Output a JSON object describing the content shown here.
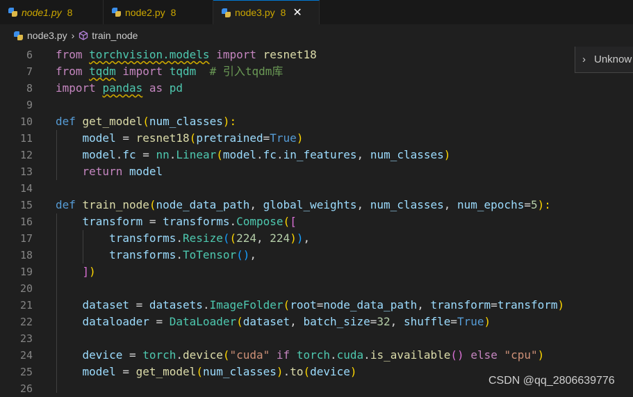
{
  "tabs": [
    {
      "name": "node1.py",
      "problems": "8"
    },
    {
      "name": "node2.py",
      "problems": "8"
    },
    {
      "name": "node3.py",
      "problems": "8",
      "close": "✕"
    }
  ],
  "breadcrumb": {
    "file": "node3.py",
    "separator": "›",
    "symbol": "train_node"
  },
  "peek": {
    "chevron": "›",
    "label": "Unknow"
  },
  "line_numbers": [
    "6",
    "7",
    "8",
    "9",
    "10",
    "11",
    "12",
    "13",
    "14",
    "15",
    "16",
    "17",
    "18",
    "19",
    "20",
    "21",
    "22",
    "23",
    "24",
    "25",
    "26"
  ],
  "code": {
    "l6": [
      "from",
      " ",
      "torchvision.models",
      " ",
      "import",
      " ",
      "resnet18"
    ],
    "l7": [
      "from",
      " ",
      "tqdm",
      " ",
      "import",
      " ",
      "tqdm",
      "  ",
      "# 引入tqdm库"
    ],
    "l8": [
      "import",
      " ",
      "pandas",
      " ",
      "as",
      " ",
      "pd"
    ],
    "l10": [
      "def",
      " ",
      "get_model",
      "(",
      "num_classes",
      "):"
    ],
    "l11": [
      "    ",
      "model",
      " = ",
      "resnet18",
      "(",
      "pretrained",
      "=",
      "True",
      ")"
    ],
    "l12": [
      "    ",
      "model",
      ".",
      "fc",
      " = ",
      "nn",
      ".",
      "Linear",
      "(",
      "model",
      ".",
      "fc",
      ".",
      "in_features",
      ", ",
      "num_classes",
      ")"
    ],
    "l13": [
      "    ",
      "return",
      " ",
      "model"
    ],
    "l15": [
      "def",
      " ",
      "train_node",
      "(",
      "node_data_path",
      ", ",
      "global_weights",
      ", ",
      "num_classes",
      ", ",
      "num_epochs",
      "=",
      "5",
      "):"
    ],
    "l16": [
      "    ",
      "transform",
      " = ",
      "transforms",
      ".",
      "Compose",
      "(",
      "["
    ],
    "l17": [
      "        ",
      "transforms",
      ".",
      "Resize",
      "(",
      "(",
      "224",
      ", ",
      "224",
      ")",
      ")",
      ","
    ],
    "l18": [
      "        ",
      "transforms",
      ".",
      "ToTensor",
      "(",
      ")",
      ","
    ],
    "l19": [
      "    ",
      "]",
      ")"
    ],
    "l21": [
      "    ",
      "dataset",
      " = ",
      "datasets",
      ".",
      "ImageFolder",
      "(",
      "root",
      "=",
      "node_data_path",
      ", ",
      "transform",
      "=",
      "transform",
      ")"
    ],
    "l22": [
      "    ",
      "dataloader",
      " = ",
      "DataLoader",
      "(",
      "dataset",
      ", ",
      "batch_size",
      "=",
      "32",
      ", ",
      "shuffle",
      "=",
      "True",
      ")"
    ],
    "l24": [
      "    ",
      "device",
      " = ",
      "torch",
      ".",
      "device",
      "(",
      "\"cuda\"",
      " ",
      "if",
      " ",
      "torch",
      ".",
      "cuda",
      ".",
      "is_available",
      "(",
      ")",
      " ",
      "else",
      " ",
      "\"cpu\"",
      ")"
    ],
    "l25": [
      "    ",
      "model",
      " = ",
      "get_model",
      "(",
      "num_classes",
      ")",
      ".",
      "to",
      "(",
      "device",
      ")"
    ]
  },
  "watermark": "CSDN @qq_2806639776"
}
